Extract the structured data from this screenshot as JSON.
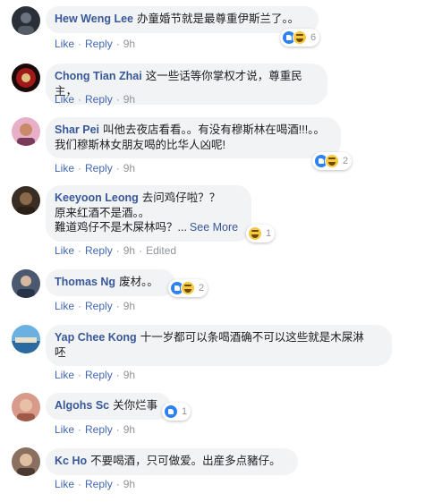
{
  "comments": [
    {
      "author": "Hew Weng Lee",
      "text": "办童婚节就是最尊重伊斯兰了。。",
      "like": "Like",
      "reply": "Reply",
      "time": "9h",
      "reaction_count": "6",
      "avatar_color": "#3a3f4a"
    },
    {
      "author": "Chong Tian Zhai",
      "text": "这一些话等你掌权才说，尊重民主，",
      "like": "Like",
      "reply": "Reply",
      "time": "9h",
      "reaction_count": "",
      "avatar_color": "#8b1a1a"
    },
    {
      "author": "Shar Pei",
      "line1": "叫他去夜店看看。。有没有穆斯林在喝酒!!!。。",
      "line2": "我们穆斯林女朋友喝的比华人凶呢!",
      "like": "Like",
      "reply": "Reply",
      "time": "9h",
      "reaction_count": "2",
      "avatar_color": "#b05a7a"
    },
    {
      "author": "Keeyoon Leong",
      "line1": "去问鸡仔啦？？",
      "line2": "原来红酒不是酒。。",
      "line3": "難道鸡仔不是木屎林吗？...",
      "see_more": "See More",
      "like": "Like",
      "reply": "Reply",
      "time": "9h",
      "edited": "Edited",
      "reaction_count": "1",
      "avatar_color": "#5a4a3a"
    },
    {
      "author": "Thomas Ng",
      "text": "废材。。",
      "like": "Like",
      "reply": "Reply",
      "time": "9h",
      "reaction_count": "2",
      "avatar_color": "#4a5a70"
    },
    {
      "author": "Yap Chee Kong",
      "line1": "十一岁都可以条喝酒确不可以这些就是木屎淋",
      "line2": "呸",
      "like": "Like",
      "reply": "Reply",
      "time": "9h",
      "reaction_count": "",
      "avatar_color": "#3b7fb5"
    },
    {
      "author": "Algohs Sc",
      "text": "关你烂事",
      "like": "Like",
      "reply": "Reply",
      "time": "9h",
      "reaction_count": "1",
      "avatar_color": "#c47a6a"
    },
    {
      "author": "Kc Ho",
      "text": "不要喝酒，只可做爱。出産多点豬仔。",
      "like": "Like",
      "reply": "Reply",
      "time": "9h",
      "reaction_count": "",
      "avatar_color": "#6a5040"
    }
  ]
}
